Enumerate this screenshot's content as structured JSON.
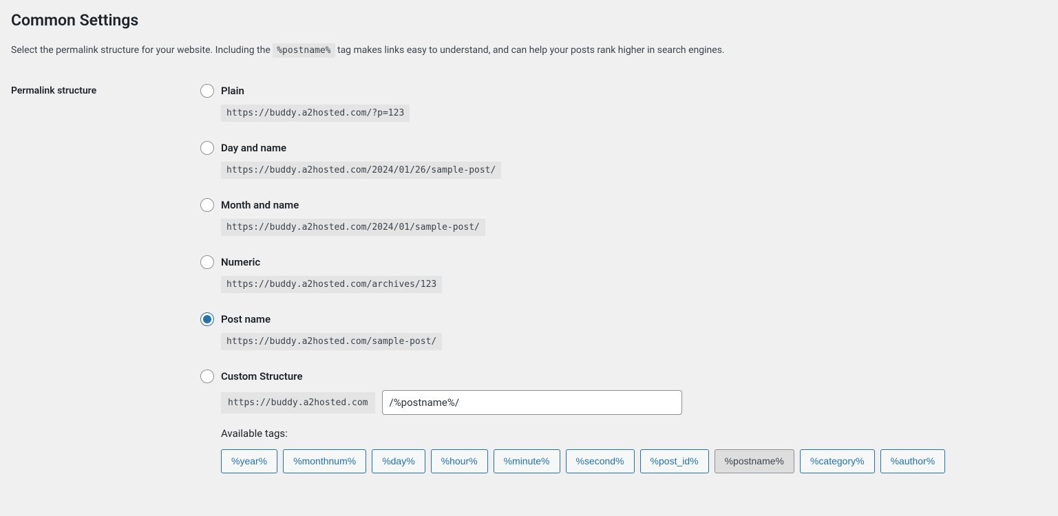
{
  "section": {
    "title": "Common Settings",
    "description_prefix": "Select the permalink structure for your website. Including the ",
    "description_code": "%postname%",
    "description_suffix": " tag makes links easy to understand, and can help your posts rank higher in search engines."
  },
  "form": {
    "label": "Permalink structure",
    "options": [
      {
        "label": "Plain",
        "example": "https://buddy.a2hosted.com/?p=123",
        "checked": false
      },
      {
        "label": "Day and name",
        "example": "https://buddy.a2hosted.com/2024/01/26/sample-post/",
        "checked": false
      },
      {
        "label": "Month and name",
        "example": "https://buddy.a2hosted.com/2024/01/sample-post/",
        "checked": false
      },
      {
        "label": "Numeric",
        "example": "https://buddy.a2hosted.com/archives/123",
        "checked": false
      },
      {
        "label": "Post name",
        "example": "https://buddy.a2hosted.com/sample-post/",
        "checked": true
      }
    ],
    "custom": {
      "label": "Custom Structure",
      "prefix": "https://buddy.a2hosted.com",
      "value": "/%postname%/"
    },
    "available_tags_label": "Available tags:",
    "tags": [
      {
        "text": "%year%",
        "active": false
      },
      {
        "text": "%monthnum%",
        "active": false
      },
      {
        "text": "%day%",
        "active": false
      },
      {
        "text": "%hour%",
        "active": false
      },
      {
        "text": "%minute%",
        "active": false
      },
      {
        "text": "%second%",
        "active": false
      },
      {
        "text": "%post_id%",
        "active": false
      },
      {
        "text": "%postname%",
        "active": true
      },
      {
        "text": "%category%",
        "active": false
      },
      {
        "text": "%author%",
        "active": false
      }
    ]
  }
}
